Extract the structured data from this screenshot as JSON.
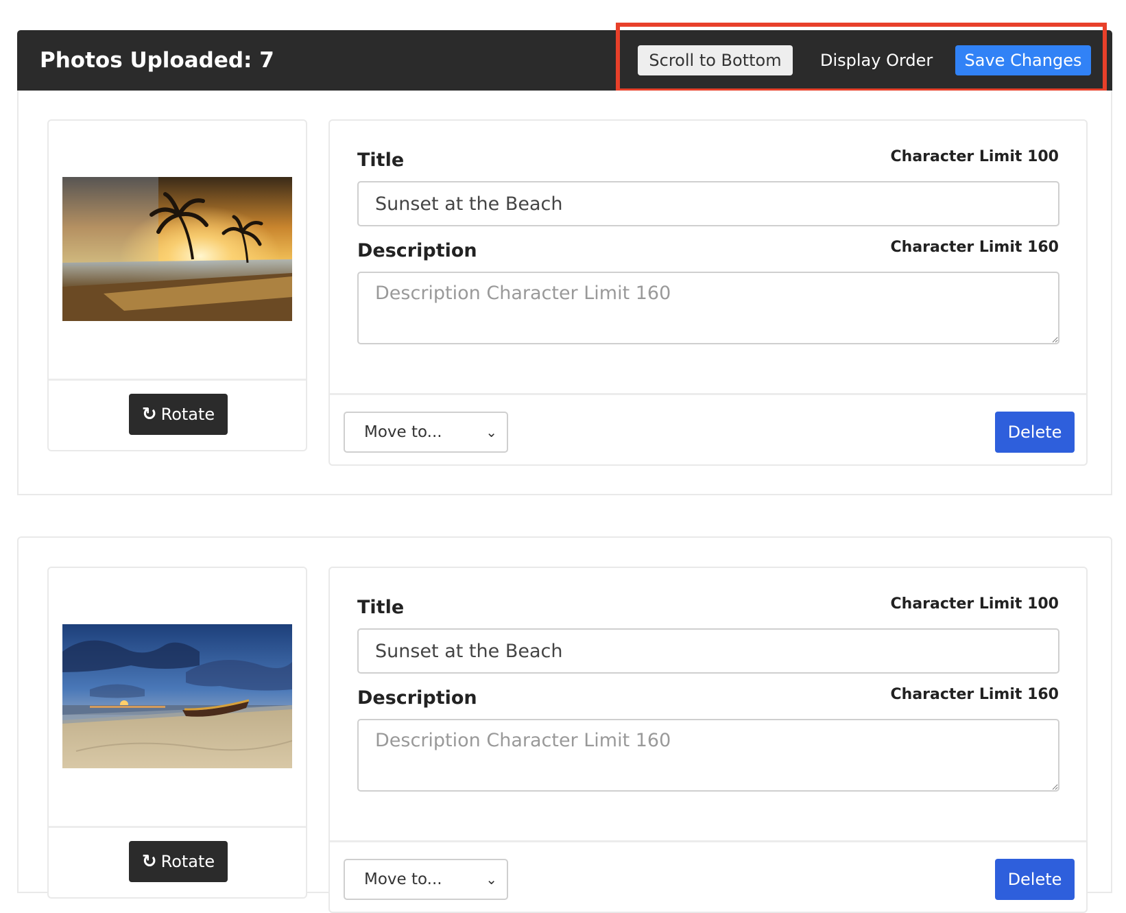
{
  "header": {
    "title": "Photos Uploaded: 7",
    "scroll_button": "Scroll to Bottom",
    "display_order_link": "Display Order",
    "save_button": "Save Changes",
    "highlight_color": "#e8402a",
    "save_color": "#3182f6"
  },
  "photos": [
    {
      "image": "sunset-palm-beach",
      "rotate_label": "Rotate",
      "rotate_icon": "↻",
      "title_label": "Title",
      "title_limit": "Character Limit 100",
      "title_value": "Sunset at the Beach",
      "description_label": "Description",
      "description_limit": "Character Limit 160",
      "description_value": "",
      "description_placeholder": "Description Character Limit 160",
      "move_select": "Move to...",
      "delete_label": "Delete"
    },
    {
      "image": "beach-boat-sunset",
      "rotate_label": "Rotate",
      "rotate_icon": "↻",
      "title_label": "Title",
      "title_limit": "Character Limit 100",
      "title_value": "Sunset at the Beach",
      "description_label": "Description",
      "description_limit": "Character Limit 160",
      "description_value": "",
      "description_placeholder": "Description Character Limit 160",
      "move_select": "Move to...",
      "delete_label": "Delete"
    }
  ]
}
